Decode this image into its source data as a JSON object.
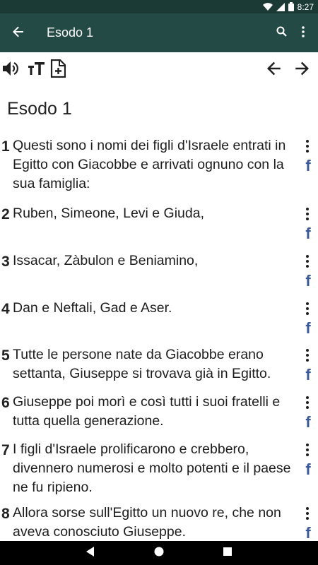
{
  "status_bar": {
    "time": "8:27"
  },
  "app_bar": {
    "title": "Esodo 1"
  },
  "chapter": {
    "title": "Esodo 1"
  },
  "verses": [
    {
      "num": "1",
      "text": "Questi sono i nomi dei figli d'Israele entrati in Egitto con Giacobbe e arrivati ognuno con la sua famiglia:"
    },
    {
      "num": "2",
      "text": "Ruben, Simeone, Levi e Giuda,"
    },
    {
      "num": "3",
      "text": "Issacar, Zàbulon e Beniamino,"
    },
    {
      "num": "4",
      "text": "Dan e Neftali, Gad e Aser."
    },
    {
      "num": "5",
      "text": "Tutte le persone nate da Giacobbe erano settanta, Giuseppe si trovava già in Egitto."
    },
    {
      "num": "6",
      "text": "Giuseppe poi morì e così tutti i suoi fratelli e tutta quella generazione."
    },
    {
      "num": "7",
      "text": "I figli d'Israele prolificarono e crebbero, divennero numerosi e molto potenti e il paese ne fu ripieno."
    },
    {
      "num": "8",
      "text": "Allora sorse sull'Egitto un nuovo re, che non aveva conosciuto Giuseppe."
    }
  ],
  "icons": {
    "facebook_glyph": "f",
    "facebook_color": "#3b5998",
    "app_bar_color": "#234a44"
  }
}
